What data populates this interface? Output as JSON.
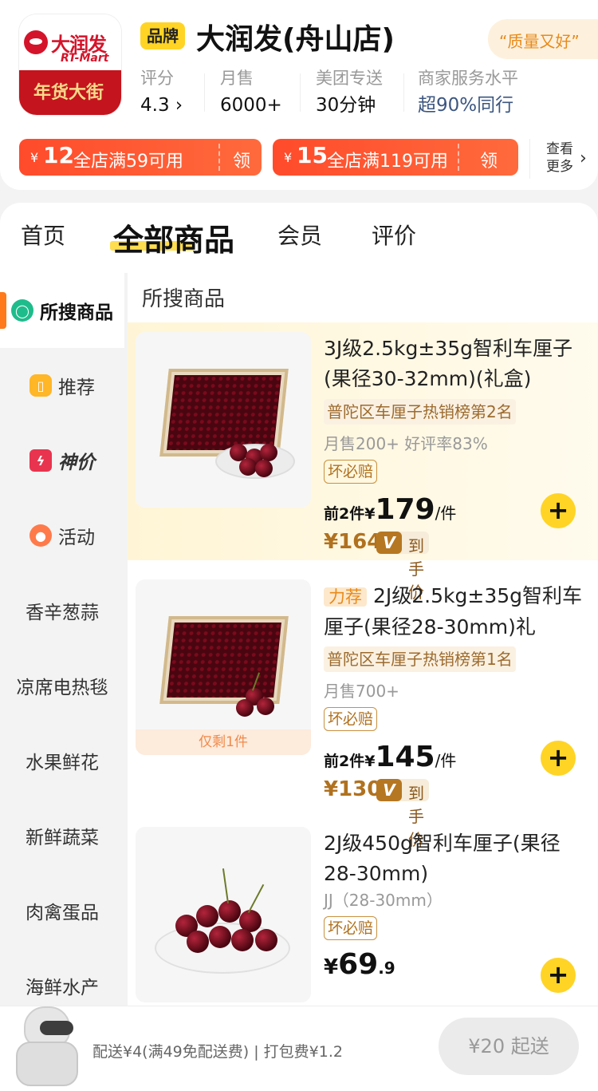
{
  "store": {
    "logo_cn": "大润发",
    "logo_en": "RT-Mart",
    "logo_banner": "年货大街",
    "brand_badge": "品牌",
    "name": "大润发(舟山店)",
    "quality_tag": "“质量又好”",
    "stats": [
      {
        "label": "评分",
        "value": "4.3 ›"
      },
      {
        "label": "月售",
        "value": "6000+"
      },
      {
        "label": "美团专送",
        "value": "30分钟"
      },
      {
        "label": "商家服务水平",
        "value": "超90%同行"
      }
    ],
    "coupons": [
      {
        "yen": "¥",
        "amount": "12",
        "condition": "全店满59可用",
        "action": "领"
      },
      {
        "yen": "¥",
        "amount": "15",
        "condition": "全店满119可用",
        "action": "领"
      }
    ],
    "view_more": "查看更多",
    "view_more_icon": "chevron-right-icon"
  },
  "tabs": [
    "首页",
    "全部商品",
    "会员",
    "评价"
  ],
  "active_tab": "全部商品",
  "sidebar": {
    "items": [
      {
        "label": "所搜商品",
        "icon": "search-icon"
      },
      {
        "label": "推荐",
        "icon": "recommend-icon"
      },
      {
        "label": "神价",
        "icon": "lightning-icon"
      },
      {
        "label": "活动",
        "icon": "location-icon"
      },
      {
        "label": "香辛葱蒜"
      },
      {
        "label": "凉席电热毯"
      },
      {
        "label": "水果鲜花"
      },
      {
        "label": "新鲜蔬菜"
      },
      {
        "label": "肉禽蛋品"
      },
      {
        "label": "海鲜水产"
      }
    ]
  },
  "main": {
    "section_title": "所搜商品",
    "products": [
      {
        "title": "3J级2.5kg±35g智利车厘子(果径30-32mm)(礼盒)",
        "rank": "普陀区车厘子热销榜第2名",
        "sales": "月售200+   好评率83%",
        "guarantee": "坏必赔",
        "price_prefix": "前2件¥",
        "price": "179",
        "price_unit": "/件",
        "vip_price": "¥164",
        "vip_label": "到手价"
      },
      {
        "tag": "力荐",
        "title": "2J级2.5kg±35g智利车厘子(果径28-30mm)礼",
        "rank": "普陀区车厘子热销榜第1名",
        "sales": "月售700+",
        "guarantee": "坏必赔",
        "note": "仅剩1件",
        "price_prefix": "前2件¥",
        "price": "145",
        "price_unit": "/件",
        "vip_price": "¥130",
        "vip_label": "到手价"
      },
      {
        "title": "2J级450g智利车厘子(果径28-30mm)",
        "spec": "JJ（28-30mm）",
        "guarantee": "坏必赔",
        "price_prefix": "¥",
        "price": "69",
        "price_decimal": ".9"
      }
    ]
  },
  "bottom": {
    "delivery_info": "配送¥4(满49免配送费) | 打包费¥1.2",
    "min_order": "¥20 起送"
  }
}
